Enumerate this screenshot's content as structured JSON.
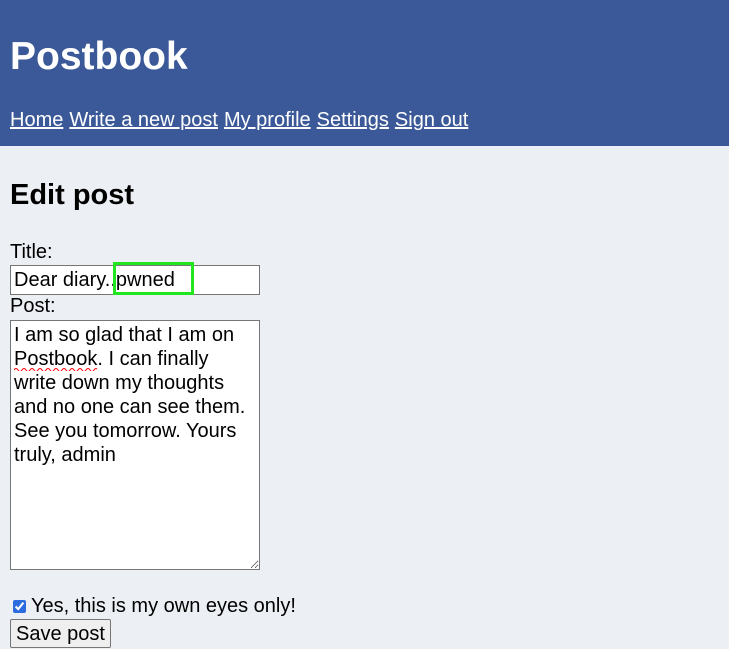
{
  "app": {
    "title": "Postbook"
  },
  "nav": {
    "items": [
      {
        "label": "Home"
      },
      {
        "label": "Write a new post"
      },
      {
        "label": "My profile"
      },
      {
        "label": "Settings"
      },
      {
        "label": "Sign out"
      }
    ]
  },
  "page": {
    "heading": "Edit post"
  },
  "form": {
    "title_label": "Title:",
    "title_value": "Dear diary..pwned",
    "post_label": "Post:",
    "post_value": "I am so glad that I am on Postbook. I can finally write down my thoughts and no one can see them. See you tomorrow. Yours truly, admin",
    "private_checked": true,
    "private_label": "Yes, this is my own eyes only!",
    "save_label": "Save post"
  },
  "colors": {
    "header_bg": "#3b5998",
    "page_bg": "#eceff4",
    "highlight": "#21e51d",
    "spellcheck": "#ff0000"
  },
  "icons": {
    "highlight": "selection-highlight-box",
    "spellcheck": "spellcheck-squiggle-icon",
    "resize": "resize-handle-icon"
  }
}
